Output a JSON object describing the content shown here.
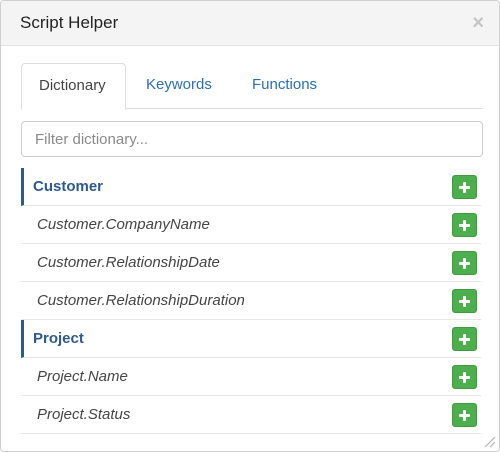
{
  "dialog": {
    "title": "Script Helper",
    "close_glyph": "×"
  },
  "tabs": [
    {
      "label": "Dictionary",
      "active": true
    },
    {
      "label": "Keywords",
      "active": false
    },
    {
      "label": "Functions",
      "active": false
    }
  ],
  "filter": {
    "placeholder": "Filter dictionary...",
    "value": ""
  },
  "groups": [
    {
      "name": "Customer",
      "items": [
        "Customer.CompanyName",
        "Customer.RelationshipDate",
        "Customer.RelationshipDuration"
      ]
    },
    {
      "name": "Project",
      "items": [
        "Project.Name",
        "Project.Status"
      ]
    }
  ],
  "icons": {
    "add": "plus-icon",
    "close": "close-icon",
    "resize": "resize-handle-icon"
  },
  "colors": {
    "accent": "#2d5a8c",
    "link": "#2a6fb0",
    "add_button": "#4cae4c"
  }
}
